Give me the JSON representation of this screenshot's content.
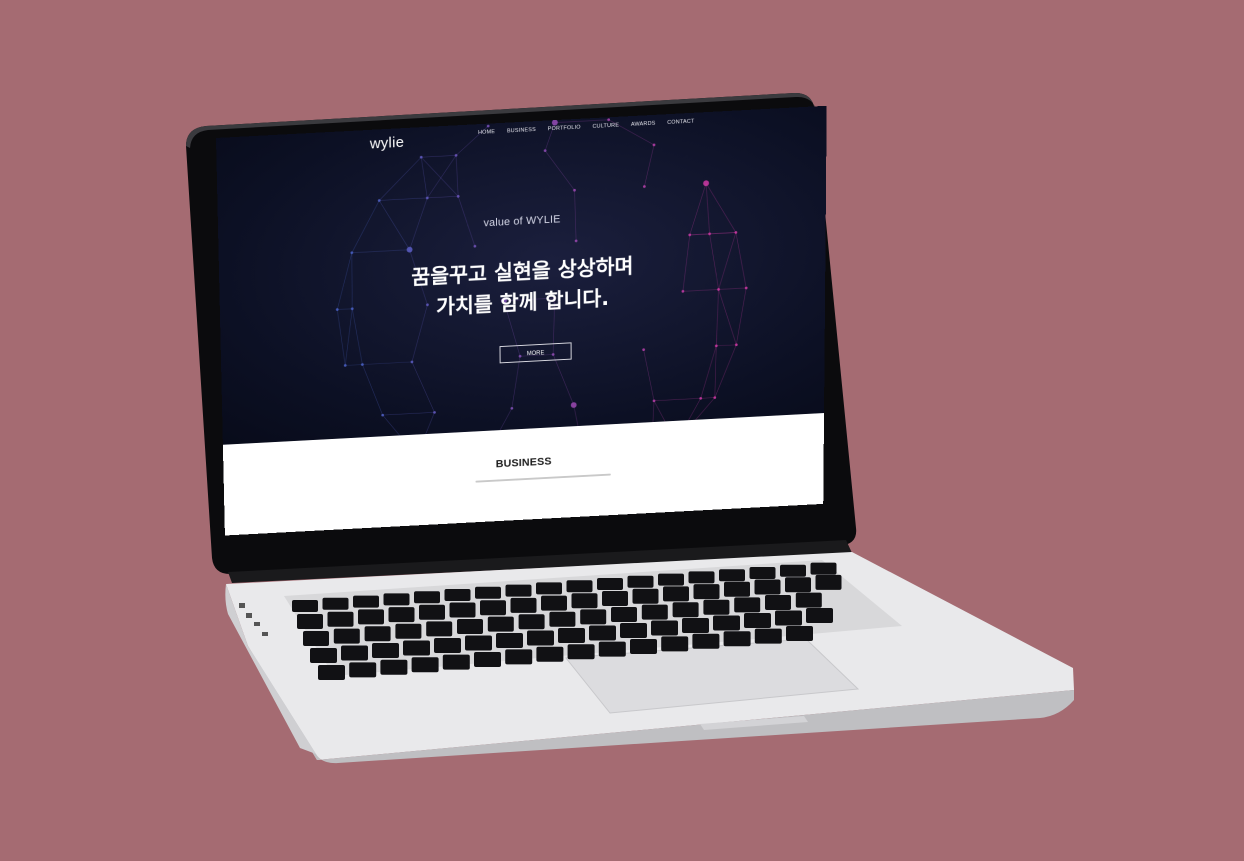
{
  "colors": {
    "background": "#a56b72",
    "hero_bg": "#0e1226",
    "accent_pink": "#d13aa6",
    "accent_blue": "#4b63c9"
  },
  "site": {
    "logo": "wylie",
    "nav": [
      "HOME",
      "BUSINESS",
      "PORTFOLIO",
      "CULTURE",
      "AWARDS",
      "CONTACT"
    ]
  },
  "hero": {
    "subtitle": "value of WYLIE",
    "headline_line1": "꿈을꾸고 실현을 상상하며",
    "headline_line2": "가치를 함께 합니다.",
    "button": "MORE"
  },
  "section": {
    "title": "BUSINESS"
  },
  "icons": {
    "camera": "webcam-icon"
  }
}
